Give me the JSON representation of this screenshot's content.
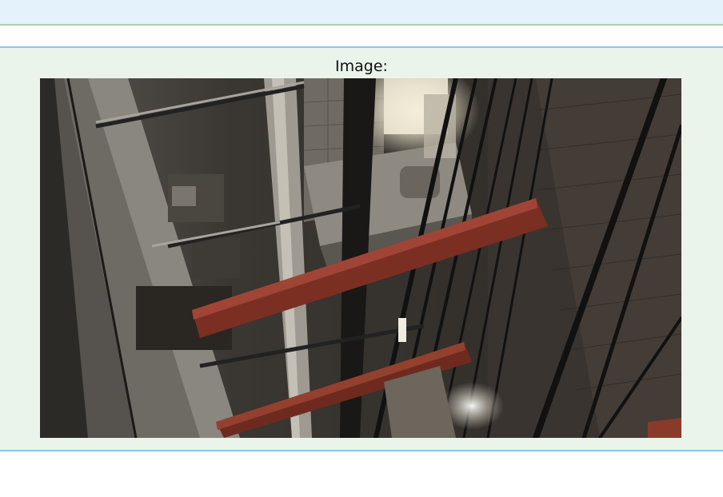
{
  "panel": {
    "label": "Image:"
  },
  "image": {
    "subject": "elevator-shaft-photo"
  },
  "colors": {
    "banner_bg": "#e3f2fb",
    "panel_bg": "#eaf4ea",
    "divider_green": "#a7d3a7",
    "divider_blue": "#8dc4ea"
  }
}
